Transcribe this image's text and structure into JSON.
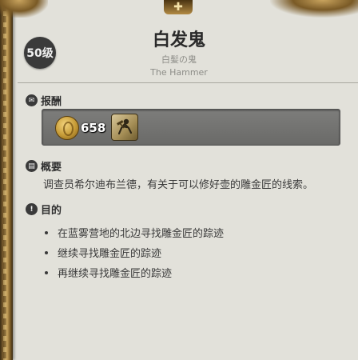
{
  "quest": {
    "level": "50级",
    "title": "白发鬼",
    "title_jp": "白髪の鬼",
    "title_en": "The Hammer"
  },
  "rewards": {
    "label": "报酬",
    "gil_amount": "658",
    "icons": [
      "gil-coin-icon",
      "hammer-item-icon"
    ]
  },
  "summary": {
    "label": "概要",
    "text": "调查员希尔迪布兰德，有关于可以修好壶的雕金匠的线索。"
  },
  "objectives": {
    "label": "目的",
    "items": [
      "在蓝雾营地的北边寻找雕金匠的踪迹",
      "继续寻找雕金匠的踪迹",
      "再继续寻找雕金匠的踪迹"
    ]
  },
  "colors": {
    "background": "#e2e1da",
    "frame_gold": "#c9a45e",
    "reward_box": "#757573"
  }
}
